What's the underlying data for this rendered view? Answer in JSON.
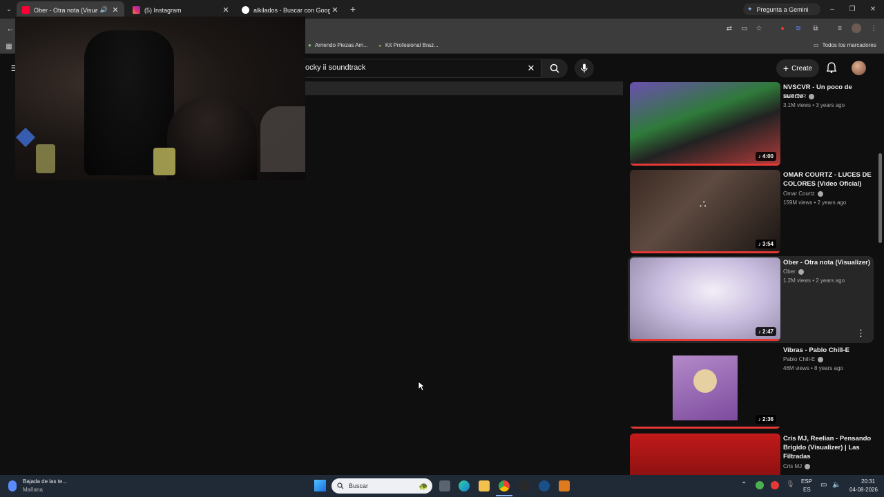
{
  "tabs": [
    {
      "title": "Ober - Otra nota (Visualizer",
      "active": true
    },
    {
      "title": "(5) Instagram",
      "active": false
    },
    {
      "title": "alkilados - Buscar con Google",
      "active": false
    }
  ],
  "gemini_label": "Pregunta a Gemini",
  "bookmarks": {
    "items": [
      "Arriendo Piezas Am...",
      "Kit Profesional Braz..."
    ],
    "all": "Todos los marcadores"
  },
  "youtube": {
    "search_query": "ocky ii soundtrack",
    "create_label": "Create"
  },
  "recommendations": [
    {
      "title": "NVSCVR - Un poco de suerte",
      "channel": "NVSCVR",
      "meta": "3.1M views • 3 years ago",
      "duration": "4:00"
    },
    {
      "title": "OMAR COURTZ - LUCES DE COLORES (Video Oficial)",
      "channel": "Omar Courtz",
      "meta": "159M views • 2 years ago",
      "duration": "3:54"
    },
    {
      "title": "Ober - Otra nota (Visualizer)",
      "channel": "Ober",
      "meta": "1.2M views • 2 years ago",
      "duration": "2:47"
    },
    {
      "title": "Vibras - Pablo Chill-E",
      "channel": "Pablo Chill-E",
      "meta": "46M views • 8 years ago",
      "duration": "2:36"
    },
    {
      "title": "Cris MJ, Reelian - Pensando Brigido (Visualizer) | Las Filtradas",
      "channel": "Cris MJ",
      "meta": "",
      "duration": ""
    }
  ],
  "taskbar": {
    "weather_title": "Bajada de las te...",
    "weather_sub": "Mañana",
    "search_placeholder": "Buscar",
    "lang_top": "ESP",
    "lang_bottom": "ES",
    "time": "20:31",
    "date": "04-08-2026"
  }
}
